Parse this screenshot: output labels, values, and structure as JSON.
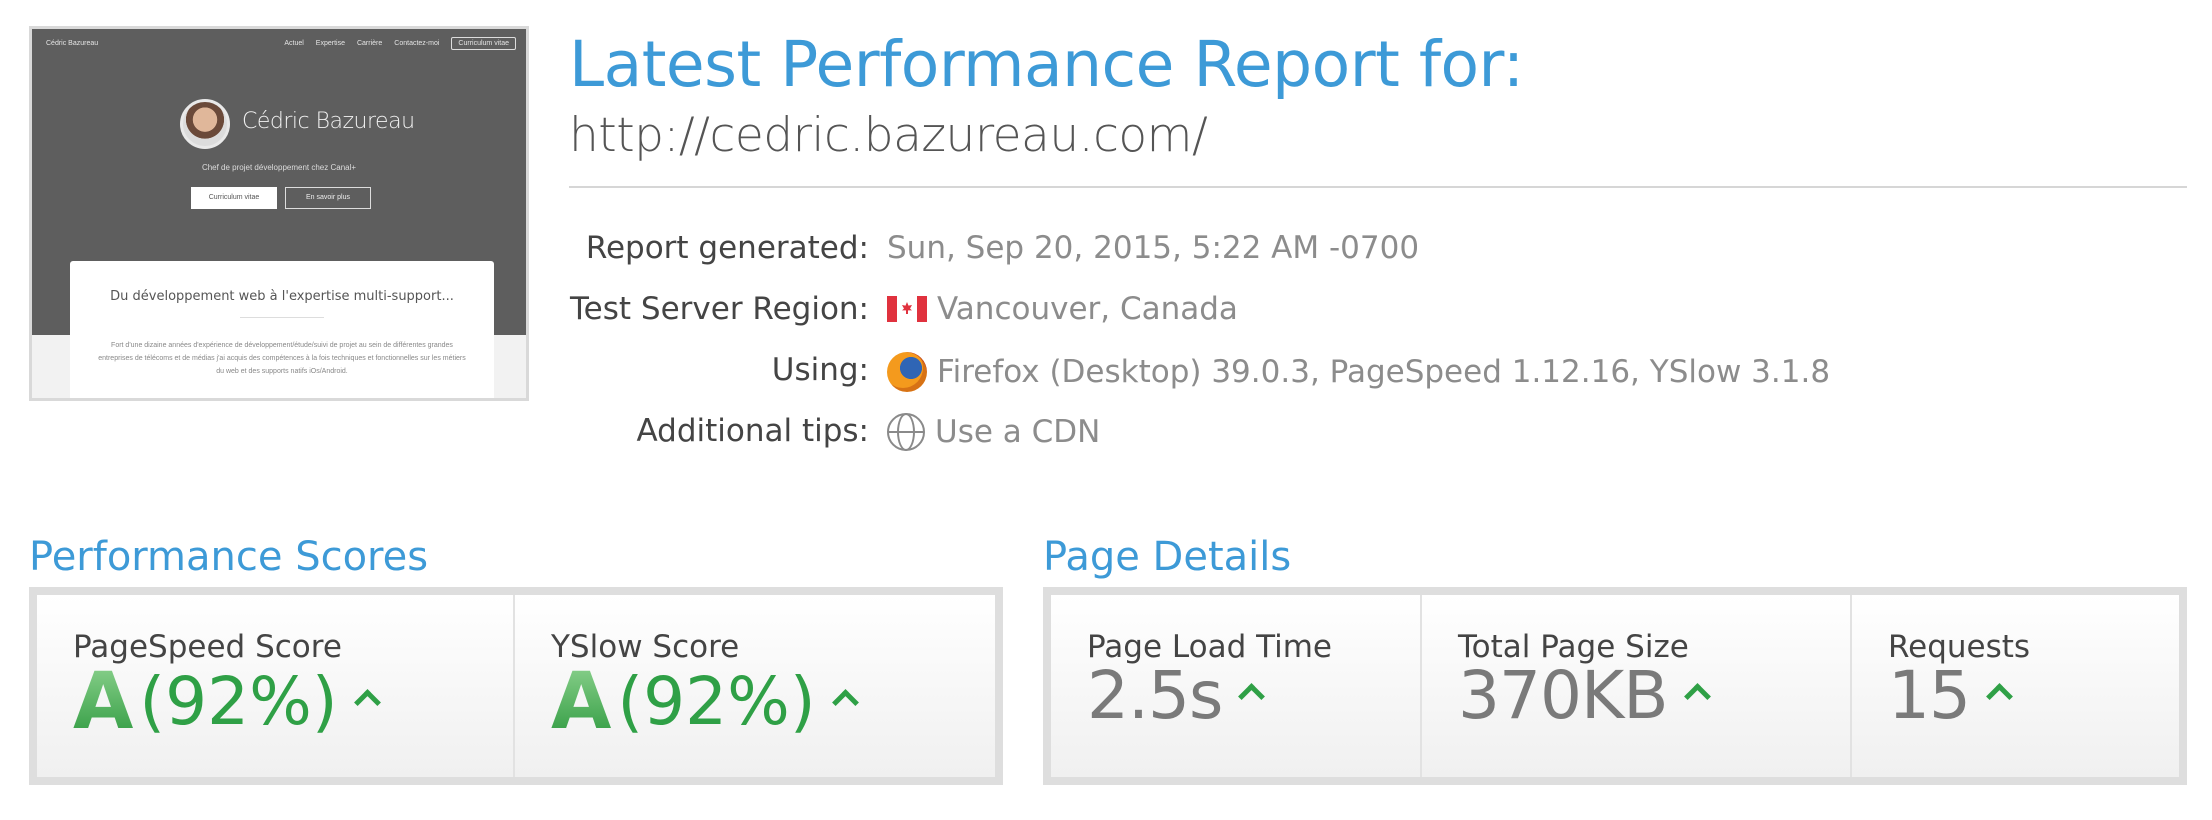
{
  "header": {
    "title": "Latest Performance Report for:",
    "url": "http://cedric.bazureau.com/"
  },
  "thumbnail": {
    "nav_brand": "Cédric Bazureau",
    "nav_links": [
      "Actuel",
      "Expertise",
      "Carrière",
      "Contactez-moi"
    ],
    "nav_cta": "Curriculum vitae",
    "name": "Cédric Bazureau",
    "subtitle": "Chef de projet développement chez Canal+",
    "btn_primary": "Curriculum vitae",
    "btn_secondary": "En savoir plus",
    "card_title": "Du développement web à l'expertise multi-support...",
    "card_text": "Fort d'une dizaine années d'expérience de développement/étude/suivi de projet au sein de différentes grandes entreprises de télécoms et de médias j'ai acquis des compétences à la fois techniques et fonctionnelles sur les métiers du web et des supports natifs iOs/Android."
  },
  "meta": {
    "report_generated_label": "Report generated:",
    "report_generated_value": "Sun, Sep 20, 2015, 5:22 AM -0700",
    "region_label": "Test Server Region:",
    "region_value": "Vancouver, Canada",
    "using_label": "Using:",
    "using_value": "Firefox (Desktop) 39.0.3, PageSpeed 1.12.16, YSlow 3.1.8",
    "tips_label": "Additional tips:",
    "tips_value": "Use a CDN"
  },
  "performance": {
    "section_title": "Performance Scores",
    "pagespeed_label": "PageSpeed Score",
    "pagespeed_grade": "A",
    "pagespeed_pct": "(92%)",
    "yslow_label": "YSlow Score",
    "yslow_grade": "A",
    "yslow_pct": "(92%)"
  },
  "details": {
    "section_title": "Page Details",
    "load_time_label": "Page Load Time",
    "load_time_value": "2.5s",
    "page_size_label": "Total Page Size",
    "page_size_value": "370KB",
    "requests_label": "Requests",
    "requests_value": "15"
  },
  "colors": {
    "accent_blue": "#3d9ad7",
    "grade_green": "#2fa046",
    "muted_gray": "#8c8c8c"
  }
}
